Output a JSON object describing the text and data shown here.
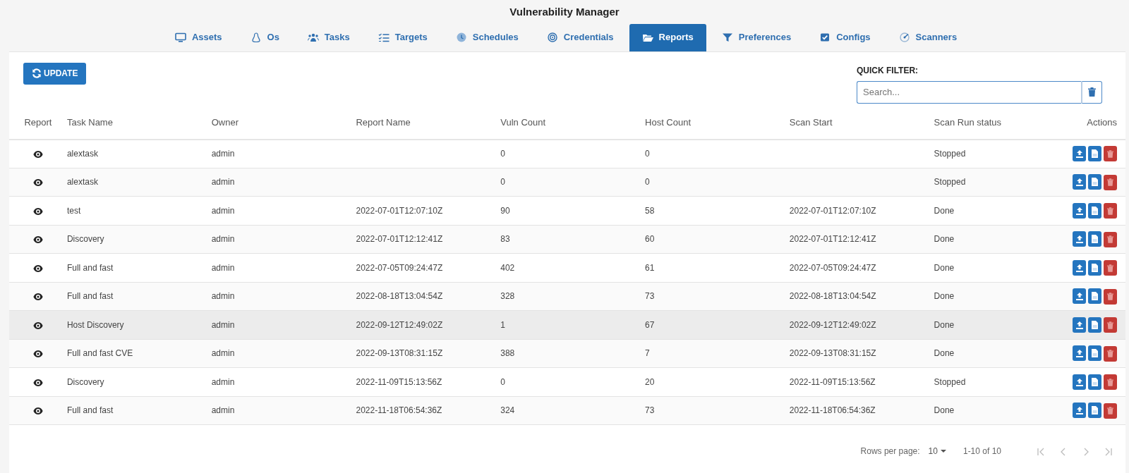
{
  "window": {
    "title": "Vulnerability Manager"
  },
  "tabs": [
    {
      "label": "Assets",
      "selected": false
    },
    {
      "label": "Os",
      "selected": false
    },
    {
      "label": "Tasks",
      "selected": false
    },
    {
      "label": "Targets",
      "selected": false
    },
    {
      "label": "Schedules",
      "selected": false
    },
    {
      "label": "Credentials",
      "selected": false
    },
    {
      "label": "Reports",
      "selected": true
    },
    {
      "label": "Preferences",
      "selected": false
    },
    {
      "label": "Configs",
      "selected": false
    },
    {
      "label": "Scanners",
      "selected": false
    }
  ],
  "update_button": "UPDATE",
  "quick_filter": {
    "label": "QUICK FILTER:",
    "placeholder": "Search..."
  },
  "table": {
    "columns": [
      "Report",
      "Task Name",
      "Owner",
      "Report Name",
      "Vuln Count",
      "Host Count",
      "Scan Start",
      "Scan Run status",
      "Actions"
    ],
    "rows": [
      {
        "task": "alextask",
        "owner": "admin",
        "report": "",
        "vulns": "0",
        "hosts": "0",
        "start": "",
        "status": "Stopped",
        "selected": false
      },
      {
        "task": "alextask",
        "owner": "admin",
        "report": "",
        "vulns": "0",
        "hosts": "0",
        "start": "",
        "status": "Stopped",
        "selected": false
      },
      {
        "task": "test",
        "owner": "admin",
        "report": "2022-07-01T12:07:10Z",
        "vulns": "90",
        "hosts": "58",
        "start": "2022-07-01T12:07:10Z",
        "status": "Done",
        "selected": false
      },
      {
        "task": "Discovery",
        "owner": "admin",
        "report": "2022-07-01T12:12:41Z",
        "vulns": "83",
        "hosts": "60",
        "start": "2022-07-01T12:12:41Z",
        "status": "Done",
        "selected": false
      },
      {
        "task": "Full and fast",
        "owner": "admin",
        "report": "2022-07-05T09:24:47Z",
        "vulns": "402",
        "hosts": "61",
        "start": "2022-07-05T09:24:47Z",
        "status": "Done",
        "selected": false
      },
      {
        "task": "Full and fast",
        "owner": "admin",
        "report": "2022-08-18T13:04:54Z",
        "vulns": "328",
        "hosts": "73",
        "start": "2022-08-18T13:04:54Z",
        "status": "Done",
        "selected": false
      },
      {
        "task": "Host Discovery",
        "owner": "admin",
        "report": "2022-09-12T12:49:02Z",
        "vulns": "1",
        "hosts": "67",
        "start": "2022-09-12T12:49:02Z",
        "status": "Done",
        "selected": true
      },
      {
        "task": "Full and fast CVE",
        "owner": "admin",
        "report": "2022-09-13T08:31:15Z",
        "vulns": "388",
        "hosts": "7",
        "start": "2022-09-13T08:31:15Z",
        "status": "Done",
        "selected": false
      },
      {
        "task": "Discovery",
        "owner": "admin",
        "report": "2022-11-09T15:13:56Z",
        "vulns": "0",
        "hosts": "20",
        "start": "2022-11-09T15:13:56Z",
        "status": "Stopped",
        "selected": false
      },
      {
        "task": "Full and fast",
        "owner": "admin",
        "report": "2022-11-18T06:54:36Z",
        "vulns": "324",
        "hosts": "73",
        "start": "2022-11-18T06:54:36Z",
        "status": "Done",
        "selected": false
      }
    ]
  },
  "pagination": {
    "rows_per_page_label": "Rows per page:",
    "rows_per_page": "10",
    "range": "1-10 of 10"
  }
}
